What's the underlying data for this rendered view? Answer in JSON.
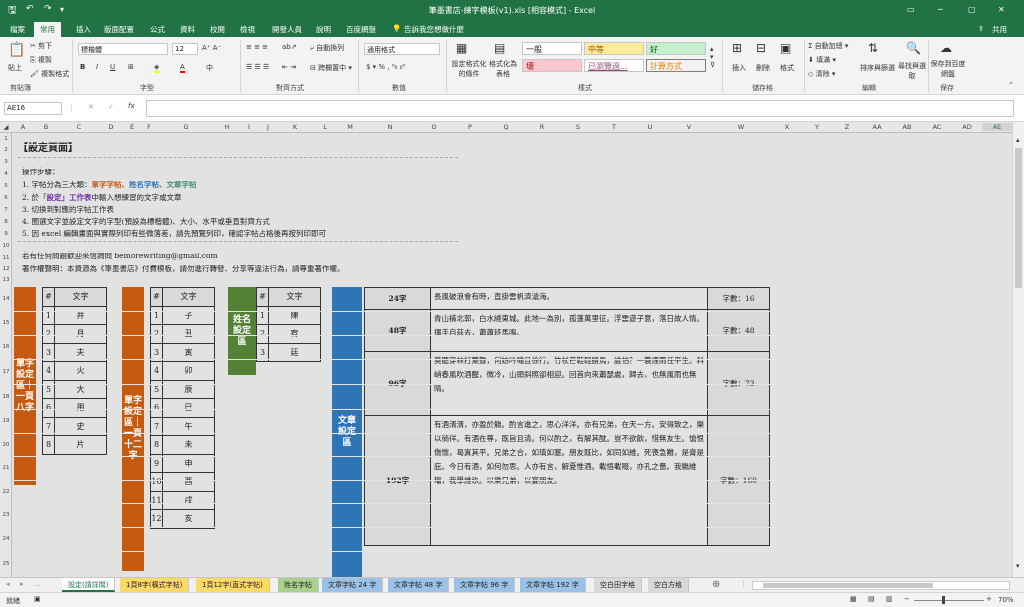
{
  "title_bar": {
    "title": "筆墨書店-練字模板(v1).xls [相容模式] - Excel",
    "user": "共用",
    "search_hint": "告訴我您想做什麼"
  },
  "tabs": [
    "檔案",
    "常用",
    "插入",
    "版面配置",
    "公式",
    "資料",
    "校閱",
    "檢視",
    "開發人員",
    "說明",
    "百度網盤"
  ],
  "ribbon": {
    "clipboard": {
      "paste": "貼上",
      "cut": "剪下",
      "copy": "複製",
      "painter": "複製格式",
      "group": "剪貼簿"
    },
    "font": {
      "name": "標楷體",
      "size": "12",
      "group": "字型"
    },
    "align": {
      "wrap": "自動換列",
      "merge": "跨欄置中",
      "group": "對齊方式"
    },
    "number": {
      "format": "通用格式",
      "group": "數值"
    },
    "styles": {
      "cond": "設定格式化的條件",
      "table": "格式化為表格",
      "s1": "一般",
      "s2": "中等",
      "s3": "好",
      "s4": "壞",
      "s5": "已瀏覽過...",
      "s6": "計算方式",
      "group": "樣式"
    },
    "cells": {
      "insert": "插入",
      "delete": "刪除",
      "format": "格式",
      "group": "儲存格"
    },
    "edit": {
      "autosum": "自動加總",
      "fill": "填滿",
      "clear": "清除",
      "sort": "排序與篩選",
      "find": "尋找與選取",
      "group": "編輯"
    },
    "save": {
      "btn": "保存到百度網盤",
      "group": "保存"
    }
  },
  "formula_bar": {
    "name_box": "AE16",
    "value": ""
  },
  "columns": [
    "A",
    "B",
    "C",
    "D",
    "E",
    "F",
    "G",
    "H",
    "I",
    "J",
    "K",
    "L",
    "M",
    "N",
    "O",
    "P",
    "Q",
    "R",
    "S",
    "T",
    "U",
    "V",
    "W",
    "X",
    "Y",
    "Z",
    "AA",
    "AB",
    "AC",
    "AD",
    "AE"
  ],
  "sheet": {
    "heading": "【設定頁面】",
    "steps_title": "操作步驟：",
    "step1_prefix": "1. 字帖分為三大類：",
    "step1_a": "單字字帖",
    "step1_b": "姓名字帖",
    "step1_c": "文章字帖",
    "step2_prefix": "2. 於「",
    "step2_kw": "設定」工作表",
    "step2_suffix": "中輸入想練習的文字或文章",
    "step3": "3. 切換到對應的字帖工作表",
    "step4": "4. 圈選文字並設定文字的字型(預設為標楷體)、大小、水平或垂直對齊方式",
    "step5": "5. 因 excel 編輯畫面與實際列印有些微落差，請先預覽列印，確認字帖占格後再按列印即可",
    "contact": "若有任何問題歡迎來信詢問 bemorewriting@gmail.com",
    "copyright": "著作權聲明：本資源為《筆墨書店》付費模板，請勿進行轉發、分享等違法行為，請尊重著作權。",
    "t1_label": "單字設定區｜一頁八字",
    "t1": [
      [
        "#",
        "文字"
      ],
      [
        "1",
        "井"
      ],
      [
        "2",
        "月"
      ],
      [
        "3",
        "夫"
      ],
      [
        "4",
        "火"
      ],
      [
        "5",
        "大"
      ],
      [
        "6",
        "用"
      ],
      [
        "7",
        "史"
      ],
      [
        "8",
        "片"
      ]
    ],
    "t2_label": "單字設定區｜一頁十二字",
    "t2": [
      [
        "#",
        "文字"
      ],
      [
        "1",
        "子"
      ],
      [
        "2",
        "丑"
      ],
      [
        "3",
        "寅"
      ],
      [
        "4",
        "卯"
      ],
      [
        "5",
        "辰"
      ],
      [
        "6",
        "巳"
      ],
      [
        "7",
        "午"
      ],
      [
        "8",
        "未"
      ],
      [
        "9",
        "申"
      ],
      [
        "10",
        "酉"
      ],
      [
        "11",
        "戌"
      ],
      [
        "12",
        "亥"
      ]
    ],
    "t3_label": "姓名設定區",
    "t3": [
      [
        "#",
        "文字"
      ],
      [
        "1",
        "陳"
      ],
      [
        "2",
        "宥"
      ],
      [
        "3",
        "廷"
      ]
    ],
    "t4_label": "文章設定區",
    "t4": [
      {
        "label": "24字",
        "text": "長風破浪會有時，直掛雲帆濟滄海。",
        "count": "字數：16"
      },
      {
        "label": "48字",
        "text": "青山橫北郭，白水繞東城。此地一為別，孤蓬萬里征。浮雲遊子意，落日故人情。揮手自茲去，蕭蕭班馬鳴。",
        "count": "字數：48"
      },
      {
        "label": "96字",
        "text": "莫聽穿林打葉聲，何妨吟嘯且徐行。竹杖芒鞋輕勝馬，誰怕？一蓑煙雨任平生。料峭春風吹酒醒，微冷，山頭斜照卻相迎。回首向來蕭瑟處，歸去，也無風雨也無晴。",
        "count": "字數：73"
      },
      {
        "label": "192字",
        "text": "有酒湑湑，亦盈於觴。酌言進之，思心洋洋。亦有兄弟，在天一方。安得致之，樂以徜徉。有酒在尊，既旨且清。何以酌之，有解其酖。豈不欲飲，惜無友生。愴恨傷懷，曷寘其平。兄弟之合，如瑱如塞。朋友既比，如同如維。死喪急難，是膏是庇。今日有酒，如何勿思。人亦有言，解憂惟酒。載悟載啜，亦孔之嗇。我觴維璫，我學維玖。以樂兄弟，以宴朋友。",
        "count": "字數：160"
      }
    ]
  },
  "sheet_tabs": [
    "設定(請詳閱)",
    "1頁8字(橫式字帖)",
    "1頁12字(直式字帖)",
    "姓名字帖",
    "文章字帖 24 字",
    "文章字帖 48 字",
    "文章字帖 96 字",
    "文章字帖 192 字",
    "空白田字格",
    "空白方格"
  ],
  "status": {
    "left": "就緒",
    "zoom": "70%"
  },
  "colors": {
    "excel_green": "#217346",
    "orange": "#c55a11",
    "dark_green": "#538135",
    "blue": "#2e75b6"
  }
}
